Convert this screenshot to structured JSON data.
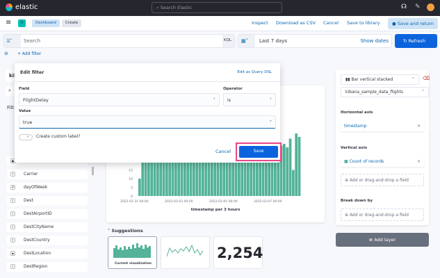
{
  "topbar": {
    "brand": "elastic",
    "search_placeholder": "Search Elastic"
  },
  "header": {
    "breadcrumbs": [
      "Dashboard",
      "Create"
    ],
    "app_badge": "D",
    "links": [
      "Inspect",
      "Download as CSV",
      "Cancel",
      "Save to library"
    ],
    "save_return": "Save and return"
  },
  "query": {
    "placeholder": "Search",
    "language": "KQL",
    "date": "Last 7 days",
    "show_dates": "Show dates",
    "refresh": "Refresh",
    "add_filter": "+ Add filter"
  },
  "sidebar": {
    "index_partial": "kil",
    "filter_partial": "Filt",
    "fields": [
      "Cancelled",
      "Carrier",
      "dayOfWeek",
      "Dest",
      "DestAirportID",
      "DestCityName",
      "DestCountry",
      "DestLocation",
      "DestRegion"
    ]
  },
  "popover": {
    "title": "Edit filter",
    "edit_dsl": "Edit as Query DSL",
    "field_label": "Field",
    "field_value": "FlightDelay",
    "operator_label": "Operator",
    "operator_value": "is",
    "value_label": "Value",
    "value_value": "true",
    "custom_label": "Create custom label?",
    "cancel": "Cancel",
    "save": "Save",
    "highlight_color": "#e7478b"
  },
  "chart_data": {
    "type": "bar",
    "xlabel": "timestamp per 3 hours",
    "ylabel": "",
    "x_ticks": [
      "2022-01-31 00:00",
      "2022-02-03 00:00",
      "2022-02-05 00:00",
      "2022-02-07 00:00"
    ],
    "y_ticks": [
      0,
      5,
      10,
      15
    ],
    "color": "#54b399",
    "values": [
      10,
      27,
      28,
      26,
      29,
      27,
      28,
      26,
      27,
      29,
      28,
      26,
      27,
      28,
      29,
      27,
      26,
      28,
      27,
      29,
      28,
      27,
      26,
      28,
      29,
      27,
      28,
      26,
      27,
      28,
      29,
      27,
      28,
      26,
      27,
      29,
      28,
      27,
      26,
      28,
      27,
      29,
      28,
      27,
      26,
      28,
      27,
      29,
      30,
      28,
      33,
      15,
      36,
      34
    ]
  },
  "suggestions": {
    "title": "Suggestions",
    "current": "Current visualization",
    "metric": "2,254"
  },
  "rpanel": {
    "chart_type": "Bar vertical stacked",
    "index": "kibana_sample_data_flights",
    "h_axis": "Horizontal axis",
    "h_field": "timestamp",
    "v_axis": "Vertical axis",
    "v_field": "Count of records",
    "add_field": "Add or drag-and-drop a field",
    "break_down": "Break down by",
    "add_field2": "Add or drag-and-drop a field",
    "add_layer": "Add layer"
  }
}
